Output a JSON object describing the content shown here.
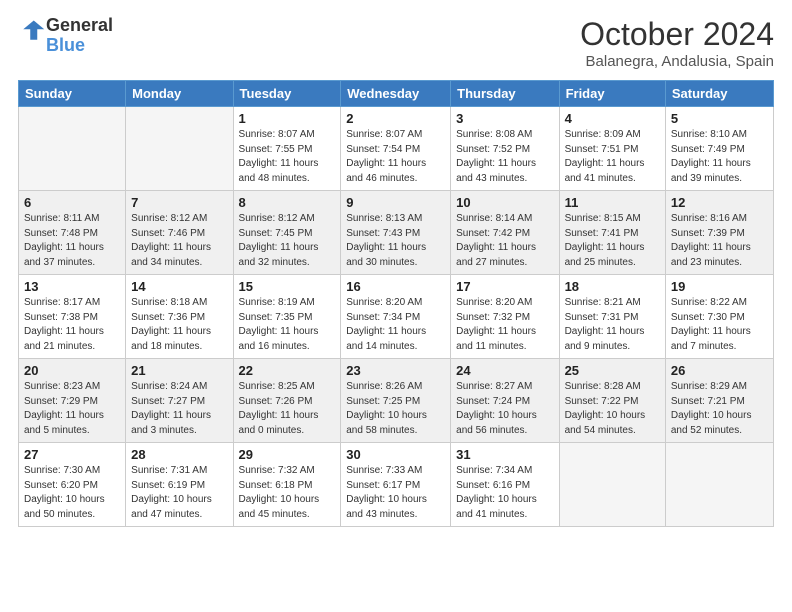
{
  "header": {
    "logo_general": "General",
    "logo_blue": "Blue",
    "title": "October 2024",
    "subtitle": "Balanegra, Andalusia, Spain"
  },
  "days_of_week": [
    "Sunday",
    "Monday",
    "Tuesday",
    "Wednesday",
    "Thursday",
    "Friday",
    "Saturday"
  ],
  "weeks": [
    [
      {
        "day": "",
        "empty": true
      },
      {
        "day": "",
        "empty": true
      },
      {
        "day": "1",
        "sunrise": "Sunrise: 8:07 AM",
        "sunset": "Sunset: 7:55 PM",
        "daylight": "Daylight: 11 hours and 48 minutes."
      },
      {
        "day": "2",
        "sunrise": "Sunrise: 8:07 AM",
        "sunset": "Sunset: 7:54 PM",
        "daylight": "Daylight: 11 hours and 46 minutes."
      },
      {
        "day": "3",
        "sunrise": "Sunrise: 8:08 AM",
        "sunset": "Sunset: 7:52 PM",
        "daylight": "Daylight: 11 hours and 43 minutes."
      },
      {
        "day": "4",
        "sunrise": "Sunrise: 8:09 AM",
        "sunset": "Sunset: 7:51 PM",
        "daylight": "Daylight: 11 hours and 41 minutes."
      },
      {
        "day": "5",
        "sunrise": "Sunrise: 8:10 AM",
        "sunset": "Sunset: 7:49 PM",
        "daylight": "Daylight: 11 hours and 39 minutes."
      }
    ],
    [
      {
        "day": "6",
        "sunrise": "Sunrise: 8:11 AM",
        "sunset": "Sunset: 7:48 PM",
        "daylight": "Daylight: 11 hours and 37 minutes."
      },
      {
        "day": "7",
        "sunrise": "Sunrise: 8:12 AM",
        "sunset": "Sunset: 7:46 PM",
        "daylight": "Daylight: 11 hours and 34 minutes."
      },
      {
        "day": "8",
        "sunrise": "Sunrise: 8:12 AM",
        "sunset": "Sunset: 7:45 PM",
        "daylight": "Daylight: 11 hours and 32 minutes."
      },
      {
        "day": "9",
        "sunrise": "Sunrise: 8:13 AM",
        "sunset": "Sunset: 7:43 PM",
        "daylight": "Daylight: 11 hours and 30 minutes."
      },
      {
        "day": "10",
        "sunrise": "Sunrise: 8:14 AM",
        "sunset": "Sunset: 7:42 PM",
        "daylight": "Daylight: 11 hours and 27 minutes."
      },
      {
        "day": "11",
        "sunrise": "Sunrise: 8:15 AM",
        "sunset": "Sunset: 7:41 PM",
        "daylight": "Daylight: 11 hours and 25 minutes."
      },
      {
        "day": "12",
        "sunrise": "Sunrise: 8:16 AM",
        "sunset": "Sunset: 7:39 PM",
        "daylight": "Daylight: 11 hours and 23 minutes."
      }
    ],
    [
      {
        "day": "13",
        "sunrise": "Sunrise: 8:17 AM",
        "sunset": "Sunset: 7:38 PM",
        "daylight": "Daylight: 11 hours and 21 minutes."
      },
      {
        "day": "14",
        "sunrise": "Sunrise: 8:18 AM",
        "sunset": "Sunset: 7:36 PM",
        "daylight": "Daylight: 11 hours and 18 minutes."
      },
      {
        "day": "15",
        "sunrise": "Sunrise: 8:19 AM",
        "sunset": "Sunset: 7:35 PM",
        "daylight": "Daylight: 11 hours and 16 minutes."
      },
      {
        "day": "16",
        "sunrise": "Sunrise: 8:20 AM",
        "sunset": "Sunset: 7:34 PM",
        "daylight": "Daylight: 11 hours and 14 minutes."
      },
      {
        "day": "17",
        "sunrise": "Sunrise: 8:20 AM",
        "sunset": "Sunset: 7:32 PM",
        "daylight": "Daylight: 11 hours and 11 minutes."
      },
      {
        "day": "18",
        "sunrise": "Sunrise: 8:21 AM",
        "sunset": "Sunset: 7:31 PM",
        "daylight": "Daylight: 11 hours and 9 minutes."
      },
      {
        "day": "19",
        "sunrise": "Sunrise: 8:22 AM",
        "sunset": "Sunset: 7:30 PM",
        "daylight": "Daylight: 11 hours and 7 minutes."
      }
    ],
    [
      {
        "day": "20",
        "sunrise": "Sunrise: 8:23 AM",
        "sunset": "Sunset: 7:29 PM",
        "daylight": "Daylight: 11 hours and 5 minutes."
      },
      {
        "day": "21",
        "sunrise": "Sunrise: 8:24 AM",
        "sunset": "Sunset: 7:27 PM",
        "daylight": "Daylight: 11 hours and 3 minutes."
      },
      {
        "day": "22",
        "sunrise": "Sunrise: 8:25 AM",
        "sunset": "Sunset: 7:26 PM",
        "daylight": "Daylight: 11 hours and 0 minutes."
      },
      {
        "day": "23",
        "sunrise": "Sunrise: 8:26 AM",
        "sunset": "Sunset: 7:25 PM",
        "daylight": "Daylight: 10 hours and 58 minutes."
      },
      {
        "day": "24",
        "sunrise": "Sunrise: 8:27 AM",
        "sunset": "Sunset: 7:24 PM",
        "daylight": "Daylight: 10 hours and 56 minutes."
      },
      {
        "day": "25",
        "sunrise": "Sunrise: 8:28 AM",
        "sunset": "Sunset: 7:22 PM",
        "daylight": "Daylight: 10 hours and 54 minutes."
      },
      {
        "day": "26",
        "sunrise": "Sunrise: 8:29 AM",
        "sunset": "Sunset: 7:21 PM",
        "daylight": "Daylight: 10 hours and 52 minutes."
      }
    ],
    [
      {
        "day": "27",
        "sunrise": "Sunrise: 7:30 AM",
        "sunset": "Sunset: 6:20 PM",
        "daylight": "Daylight: 10 hours and 50 minutes."
      },
      {
        "day": "28",
        "sunrise": "Sunrise: 7:31 AM",
        "sunset": "Sunset: 6:19 PM",
        "daylight": "Daylight: 10 hours and 47 minutes."
      },
      {
        "day": "29",
        "sunrise": "Sunrise: 7:32 AM",
        "sunset": "Sunset: 6:18 PM",
        "daylight": "Daylight: 10 hours and 45 minutes."
      },
      {
        "day": "30",
        "sunrise": "Sunrise: 7:33 AM",
        "sunset": "Sunset: 6:17 PM",
        "daylight": "Daylight: 10 hours and 43 minutes."
      },
      {
        "day": "31",
        "sunrise": "Sunrise: 7:34 AM",
        "sunset": "Sunset: 6:16 PM",
        "daylight": "Daylight: 10 hours and 41 minutes."
      },
      {
        "day": "",
        "empty": true
      },
      {
        "day": "",
        "empty": true
      }
    ]
  ]
}
